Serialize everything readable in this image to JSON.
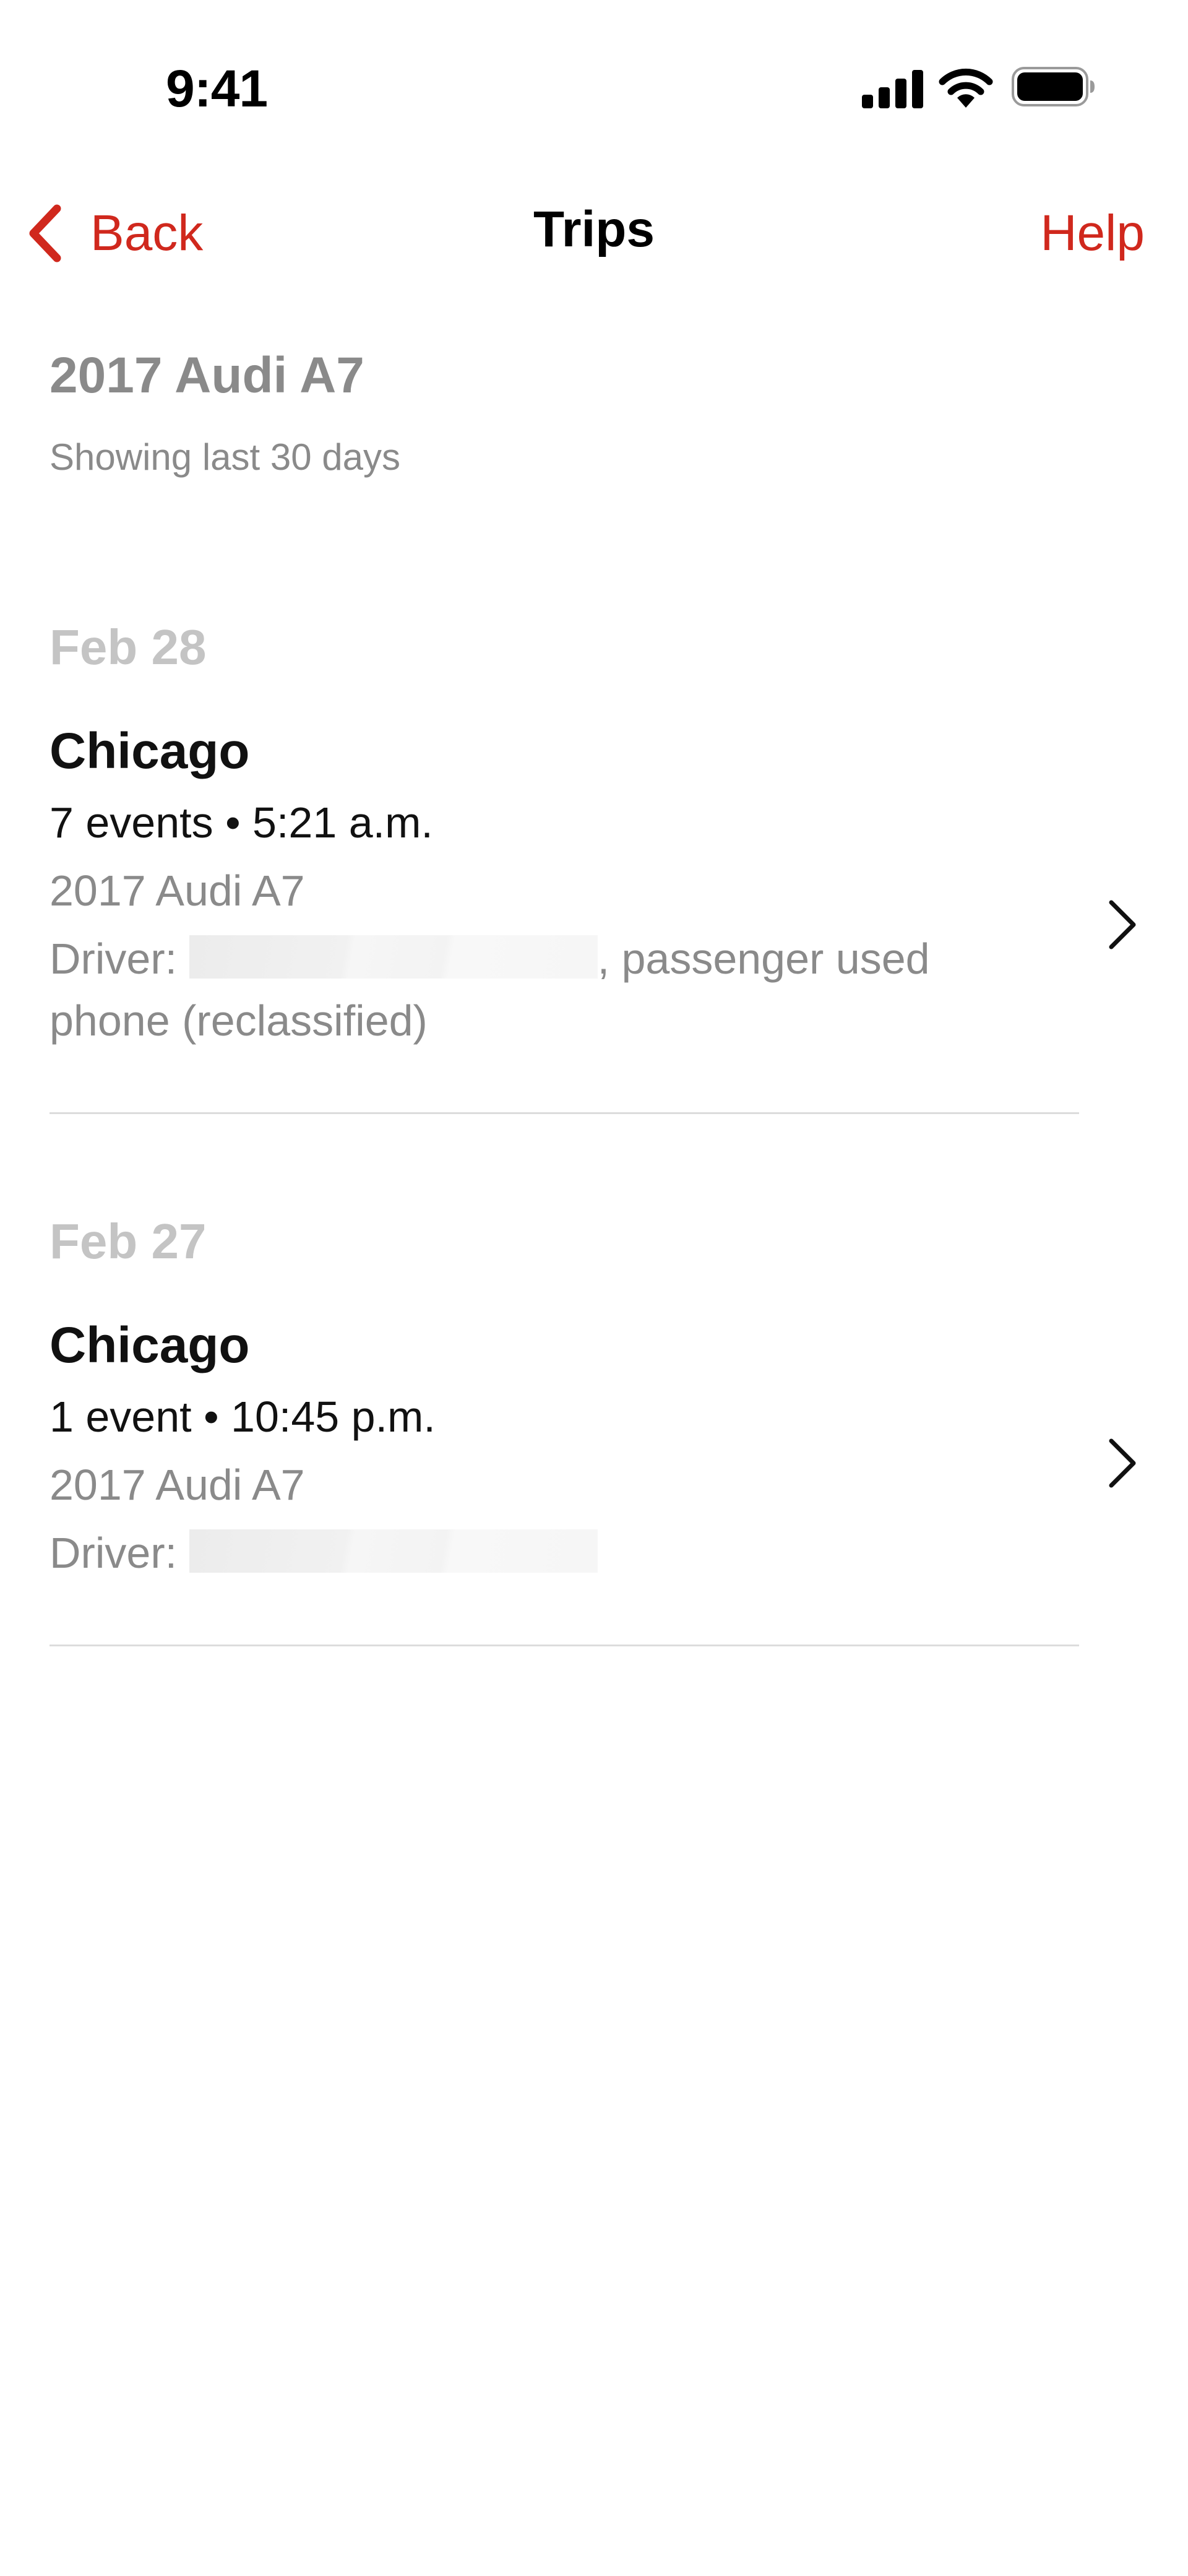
{
  "status_bar": {
    "time": "9:41",
    "icons": [
      "cellular-signal-icon",
      "wifi-icon",
      "battery-icon"
    ]
  },
  "nav": {
    "back_label": "Back",
    "title": "Trips",
    "help_label": "Help",
    "accent_color": "#d0281d"
  },
  "header": {
    "vehicle": "2017 Audi A7",
    "range": "Showing last 30 days"
  },
  "groups": [
    {
      "date": "Feb 28",
      "trip": {
        "city": "Chicago",
        "meta": "7 events • 5:21 a.m.",
        "vehicle": "2017 Audi A7",
        "driver_label": "Driver:",
        "driver_suffix": ", passenger used phone (reclassified)"
      }
    },
    {
      "date": "Feb 27",
      "trip": {
        "city": "Chicago",
        "meta": "1 event • 10:45 p.m.",
        "vehicle": "2017 Audi A7",
        "driver_label": "Driver:",
        "driver_suffix": ""
      }
    }
  ]
}
